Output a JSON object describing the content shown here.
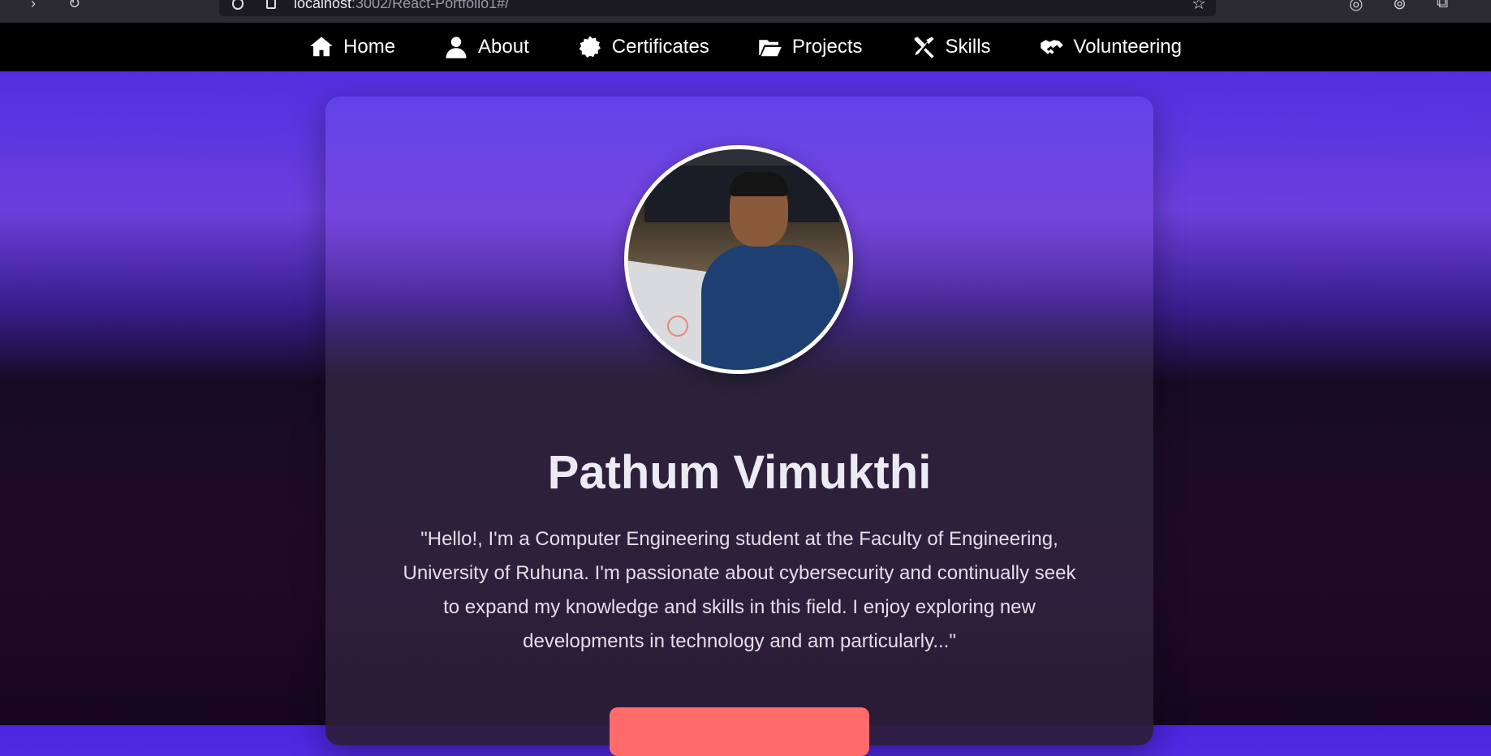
{
  "browser": {
    "url_host": "localhost",
    "url_rest": ":3002/React-Portfolio1#/"
  },
  "nav": {
    "items": [
      {
        "label": "Home",
        "icon": "home-icon"
      },
      {
        "label": "About",
        "icon": "user-icon"
      },
      {
        "label": "Certificates",
        "icon": "certificate-icon"
      },
      {
        "label": "Projects",
        "icon": "folder-open-icon"
      },
      {
        "label": "Skills",
        "icon": "tools-icon"
      },
      {
        "label": "Volunteering",
        "icon": "handshake-icon"
      }
    ]
  },
  "profile": {
    "name": "Pathum Vimukthi",
    "bio": "\"Hello!, I'm a Computer Engineering student at the Faculty of Engineering, University of Ruhuna. I'm passionate about cybersecurity and continually seek to expand my knowledge and skills in this field. I enjoy exploring new developments in technology and am particularly...\""
  },
  "colors": {
    "accent_button": "#ff6a6a",
    "navbar_bg": "#000000",
    "background_top": "#4a26e0"
  }
}
